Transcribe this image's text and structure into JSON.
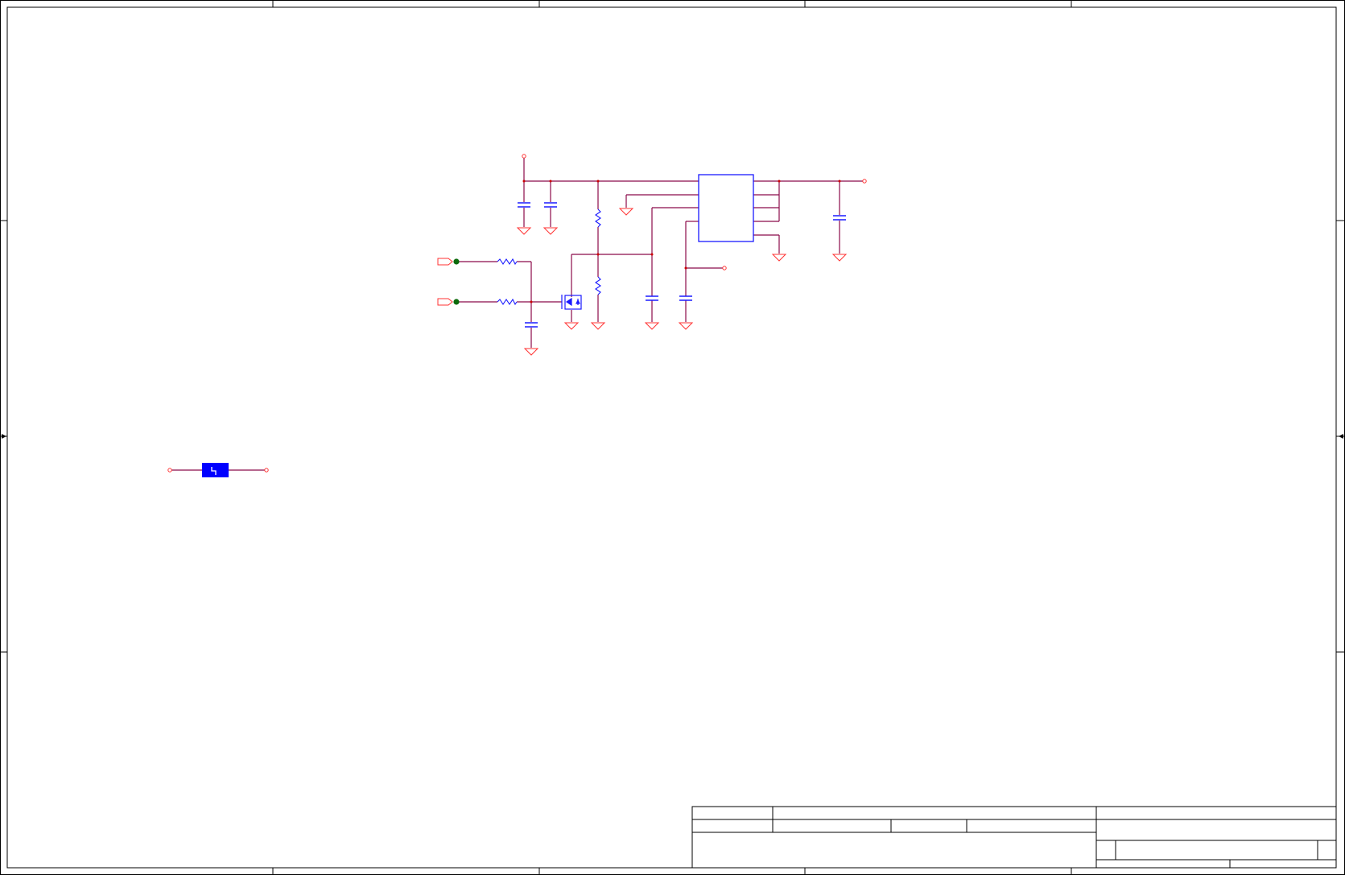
{
  "colors": {
    "background": "#ffffff",
    "frame": "#000000",
    "wire": "#8b0a4a",
    "pin": "#cc0000",
    "component": "#1a1aff",
    "power_symbol": "#ff3333",
    "port_fill": "#0b6b0b",
    "fuse_fill": "#0000ff"
  },
  "components": {
    "regulator_ic": "ic-rectangle",
    "capacitors": "capacitor-symbol",
    "resistors": "resistor-zigzag",
    "mosfet": "nmos-transistor",
    "ground": "ground-triangle",
    "fuse": "fuse-block",
    "ports": "off-sheet-connector"
  },
  "title_block": {
    "title": "",
    "size": "",
    "document_number": "",
    "revision": "",
    "date": "",
    "sheet": ""
  }
}
